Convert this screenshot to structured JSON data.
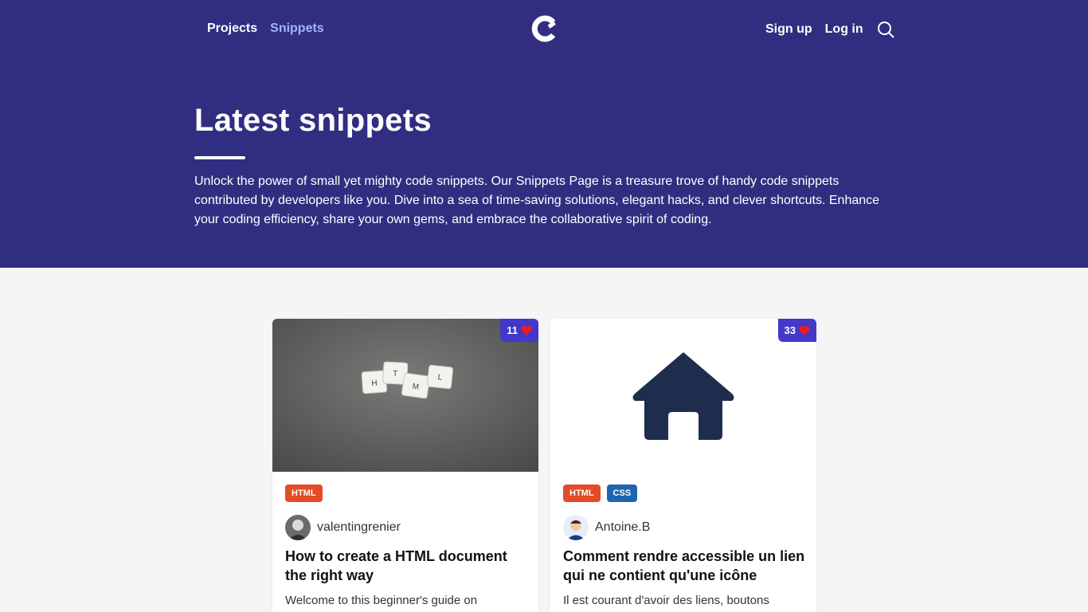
{
  "nav": {
    "projects_label": "Projects",
    "snippets_label": "Snippets",
    "signup_label": "Sign up",
    "login_label": "Log in",
    "logo_icon": "c-ring-logo-icon",
    "search_icon": "search-icon"
  },
  "hero": {
    "title": "Latest snippets",
    "description": "Unlock the power of small yet mighty code snippets. Our Snippets Page is a treasure trove of handy code snippets contributed by developers like you. Dive into a sea of time-saving solutions, elegant hacks, and clever shortcuts. Enhance your coding efficiency, share your own gems, and embrace the collaborative spirit of coding."
  },
  "colors": {
    "hero_bg": "#312e81",
    "active_nav": "#a5b4fc",
    "badge_bg": "#4338ca",
    "heart": "#ef1c1c",
    "tag_html": "#e34c26",
    "tag_css": "#1d65b0",
    "house_icon": "#1e2d4d"
  },
  "snippets": [
    {
      "likes": "11",
      "tags": [
        "HTML"
      ],
      "author": "valentingrenier",
      "title": "How to create a HTML document the right way",
      "excerpt": "Welcome to this beginner's guide on",
      "image": "html-scrabble-tiles-photo",
      "tile_letters": [
        "H",
        "T",
        "M",
        "L"
      ]
    },
    {
      "likes": "33",
      "tags": [
        "HTML",
        "CSS"
      ],
      "author": "Antoine.B",
      "title": "Comment rendre accessible un lien qui ne contient qu'une icône",
      "excerpt": "Il est courant d'avoir des liens, boutons",
      "image": "house-icon"
    }
  ]
}
